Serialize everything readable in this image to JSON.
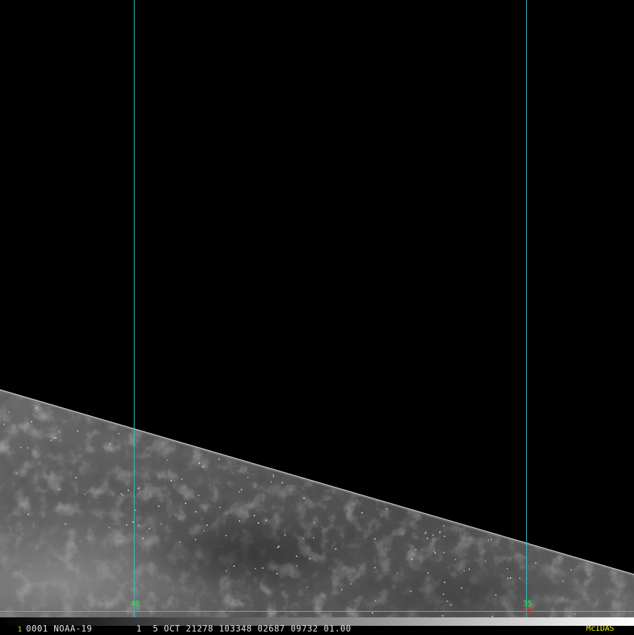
{
  "image": {
    "frame_number": "1",
    "header": "0001 NOAA-19        1  5 OCT 21278 103348 02687 09732 01.00",
    "brand": "McIDAS"
  },
  "grid_labels": {
    "left_lon": "40",
    "right_lon": "35",
    "right_lat": "50"
  },
  "colors": {
    "background": "#000000",
    "grid_line": "#34c6cc",
    "label_green": "#35e335",
    "label_red": "#e03030",
    "frame_yellow": "#e8e800",
    "header_text": "#e6e6e6",
    "brand_yellow": "#f0f000"
  }
}
